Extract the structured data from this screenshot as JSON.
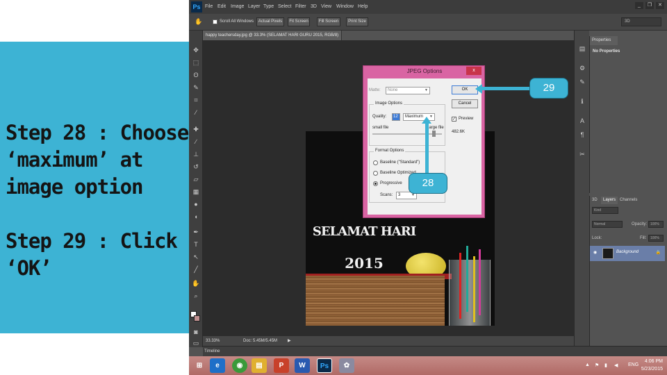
{
  "instructions": {
    "step28": "Step 28 : Choose\n‘maximum’ at\nimage option",
    "step29": "Step 29 : Click ‘OK’"
  },
  "app": {
    "logo": "Ps",
    "menus": [
      "File",
      "Edit",
      "Image",
      "Layer",
      "Type",
      "Select",
      "Filter",
      "3D",
      "View",
      "Window",
      "Help"
    ],
    "window_buttons": [
      "_",
      "❐",
      "✕"
    ]
  },
  "options_bar": {
    "scroll_all_windows": "Scroll All Windows",
    "actual_pixels": "Actual Pixels",
    "fit_screen": "Fit Screen",
    "fill_screen": "Fill Screen",
    "print_size": "Print Size",
    "workspace": "3D"
  },
  "document": {
    "tab_title": "happy teachersday.jpg @ 33.3% (SELAMAT HARI GURU 2015, RGB/8) *",
    "image_title": "SELAMAT HARI",
    "image_year": "2015",
    "zoom": "33.33%",
    "doc_size": "Doc: 5.45M/5.45M"
  },
  "panels": {
    "properties_tab": "Properties",
    "properties_empty": "No Properties",
    "layers_tabs": [
      "3D",
      "Layers",
      "Channels"
    ],
    "kind_label": "Kind",
    "blend_mode": "Normal",
    "opacity_label": "Opacity:",
    "opacity_value": "100%",
    "lock_label": "Lock:",
    "fill_label": "Fill:",
    "fill_value": "100%",
    "layer_name": "Background"
  },
  "timeline": "Timeline",
  "dialog": {
    "title": "JPEG Options",
    "close": "x",
    "matte_label": "Matte:",
    "matte_value": "None",
    "image_options_title": "Image Options",
    "quality_label": "Quality:",
    "quality_value": "12",
    "quality_preset": "Maximum",
    "small_file": "small file",
    "large_file": "large file",
    "format_options_title": "Format Options",
    "baseline_standard": "Baseline (\"Standard\")",
    "baseline_optimized": "Baseline Optimized",
    "progressive": "Progressive",
    "scans_label": "Scans:",
    "scans_value": "3",
    "ok": "OK",
    "cancel": "Cancel",
    "preview": "Preview",
    "file_size": "482.6K"
  },
  "callouts": {
    "step29_label": "29",
    "step28_label": "28"
  },
  "taskbar": {
    "language": "ENG",
    "time": "4:06 PM",
    "date": "5/23/2015"
  },
  "colors": {
    "instruction_panel": "#3db3d4",
    "dialog_frame": "#d964a3",
    "taskbar": "#b06a66"
  }
}
